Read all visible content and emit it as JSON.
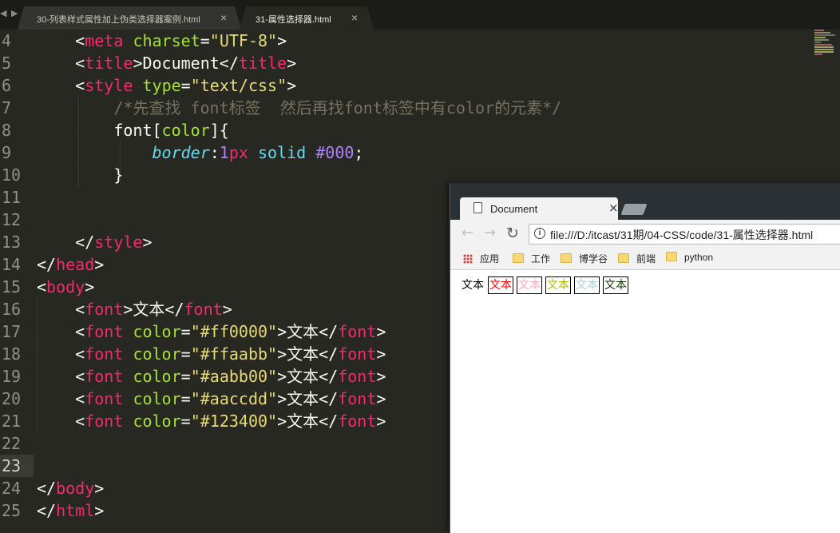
{
  "editor": {
    "nav_arrows": "◀ ▶",
    "tabs": [
      {
        "label": "30-列表样式属性加上伪类选择器案例.html",
        "close": "×"
      },
      {
        "label": "31-属性选择器.html",
        "close": "×"
      }
    ],
    "line_numbers": [
      "4",
      "5",
      "6",
      "7",
      "8",
      "9",
      "10",
      "11",
      "12",
      "13",
      "14",
      "15",
      "16",
      "17",
      "18",
      "19",
      "20",
      "21",
      "22",
      "23",
      "24",
      "25"
    ],
    "current_line": "23"
  },
  "browser": {
    "tab_title": "Document",
    "tab_close": "×",
    "url": "file:///D:/itcast/31期/04-CSS/code/31-属性选择器.html",
    "bookmarks": [
      "应用",
      "工作",
      "博学谷",
      "前端",
      "python"
    ],
    "content": {
      "plain": "文本",
      "fonts": [
        {
          "text": "文本",
          "color": "#ff0000"
        },
        {
          "text": "文本",
          "color": "#ffaabb"
        },
        {
          "text": "文本",
          "color": "#aabb00"
        },
        {
          "text": "文本",
          "color": "#aaccdd"
        },
        {
          "text": "文本",
          "color": "#123400"
        }
      ]
    }
  },
  "colors": {
    "editor_bg": "#272822",
    "tag": "#f92672",
    "attr": "#a6e22e",
    "string": "#e6db74",
    "comment": "#75715e",
    "number": "#ae81ff"
  }
}
